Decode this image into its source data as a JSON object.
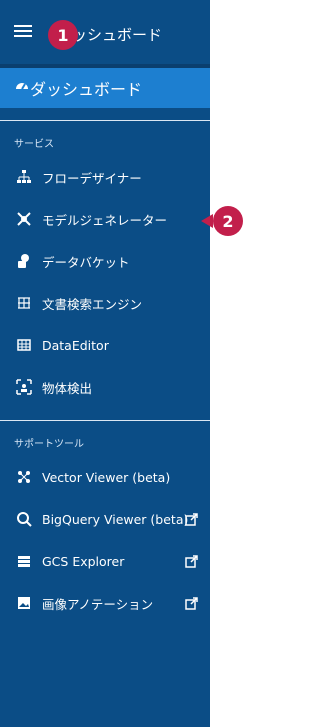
{
  "header": {
    "title": "ッシュボード",
    "menu_icon": "menu-icon"
  },
  "active": {
    "label": "ダッシュボード",
    "icon": "dashboard-icon"
  },
  "sections": {
    "services_title": "サービス",
    "services": [
      {
        "label": "フローデザイナー",
        "icon": "flow-designer-icon"
      },
      {
        "label": "モデルジェネレーター",
        "icon": "model-generator-icon"
      },
      {
        "label": "データバケット",
        "icon": "data-bucket-icon"
      },
      {
        "label": "文書検索エンジン",
        "icon": "document-search-icon"
      },
      {
        "label": "DataEditor",
        "icon": "table-icon"
      },
      {
        "label": "物体検出",
        "icon": "object-detection-icon"
      }
    ],
    "support_title": "サポートツール",
    "support": [
      {
        "label": "Vector Viewer (beta)",
        "icon": "vector-viewer-icon",
        "external": false
      },
      {
        "label": "BigQuery Viewer (beta)",
        "icon": "bigquery-icon",
        "external": true
      },
      {
        "label": "GCS Explorer",
        "icon": "gcs-icon",
        "external": true
      },
      {
        "label": "画像アノテーション",
        "icon": "image-annotation-icon",
        "external": true
      }
    ]
  },
  "badges": [
    "1",
    "2"
  ],
  "colors": {
    "sidebar": "#0b4d86",
    "active": "#1d7fd0",
    "badge": "#c21f4b"
  }
}
